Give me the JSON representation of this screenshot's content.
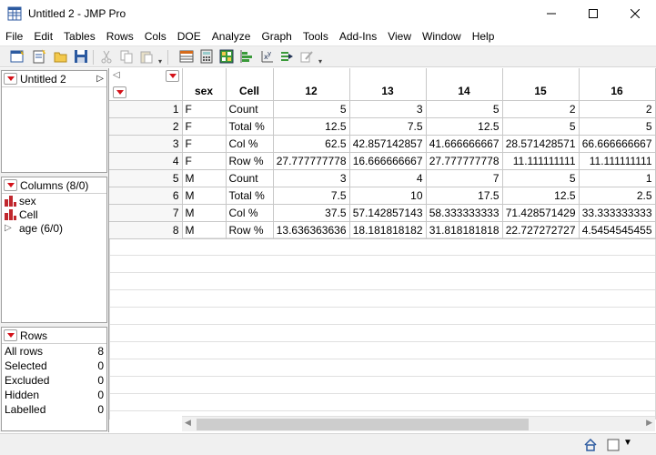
{
  "window": {
    "title": "Untitled 2 - JMP Pro"
  },
  "menu": [
    "File",
    "Edit",
    "Tables",
    "Rows",
    "Cols",
    "DOE",
    "Analyze",
    "Graph",
    "Tools",
    "Add-Ins",
    "View",
    "Window",
    "Help"
  ],
  "table_panel": {
    "name": "Untitled 2"
  },
  "columns_panel": {
    "title": "Columns (8/0)",
    "items": [
      {
        "name": "sex",
        "icon": "nominal-bar-icon"
      },
      {
        "name": "Cell",
        "icon": "nominal-bar-icon"
      },
      {
        "name": "age (6/0)",
        "icon": "group-expand-icon"
      }
    ]
  },
  "rows_panel": {
    "title": "Rows",
    "stats": [
      {
        "label": "All rows",
        "value": "8"
      },
      {
        "label": "Selected",
        "value": "0"
      },
      {
        "label": "Excluded",
        "value": "0"
      },
      {
        "label": "Hidden",
        "value": "0"
      },
      {
        "label": "Labelled",
        "value": "0"
      }
    ]
  },
  "grid": {
    "headers": [
      "sex",
      "Cell",
      "12",
      "13",
      "14",
      "15",
      "16"
    ],
    "rows": [
      [
        "1",
        "F",
        "Count",
        "5",
        "3",
        "5",
        "2",
        "2"
      ],
      [
        "2",
        "F",
        "Total %",
        "12.5",
        "7.5",
        "12.5",
        "5",
        "5"
      ],
      [
        "3",
        "F",
        "Col %",
        "62.5",
        "42.857142857",
        "41.666666667",
        "28.571428571",
        "66.666666667"
      ],
      [
        "4",
        "F",
        "Row %",
        "27.777777778",
        "16.666666667",
        "27.777777778",
        "11.111111111",
        "11.111111111"
      ],
      [
        "5",
        "M",
        "Count",
        "3",
        "4",
        "7",
        "5",
        "1"
      ],
      [
        "6",
        "M",
        "Total %",
        "7.5",
        "10",
        "17.5",
        "12.5",
        "2.5"
      ],
      [
        "7",
        "M",
        "Col %",
        "37.5",
        "57.142857143",
        "58.333333333",
        "71.428571429",
        "33.333333333"
      ],
      [
        "8",
        "M",
        "Row %",
        "13.636363636",
        "18.181818182",
        "31.818181818",
        "22.727272727",
        "4.5454545455"
      ]
    ]
  },
  "colors": {
    "accent_red": "#d4121a",
    "toolbar_bg": "#f0f0f0"
  }
}
